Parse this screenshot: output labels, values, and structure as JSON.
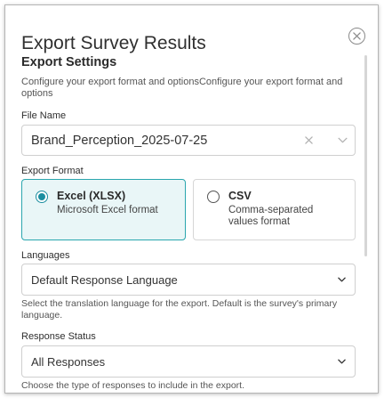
{
  "dialog": {
    "title": "Export Survey Results",
    "section_title": "Export Settings",
    "section_description": "Configure your export format and optionsConfigure your export format and options"
  },
  "file_name": {
    "label": "File Name",
    "value": "Brand_Perception_2025-07-25"
  },
  "export_format": {
    "label": "Export Format",
    "options": [
      {
        "name": "Excel (XLSX)",
        "description": "Microsoft Excel format",
        "selected": true
      },
      {
        "name": "CSV",
        "description": "Comma-separated values format",
        "selected": false
      }
    ]
  },
  "languages": {
    "label": "Languages",
    "value": "Default Response Language",
    "help": "Select the translation language for the export. Default is the survey's primary language."
  },
  "response_status": {
    "label": "Response Status",
    "value": "All Responses",
    "help": "Choose the type of responses to include in the export."
  },
  "colors": {
    "accent": "#1b8ea0",
    "selected_bg": "#e9f6f7",
    "selected_border": "#2aa6ae"
  },
  "icons": {
    "close": "close-icon",
    "clear": "clear-icon",
    "dropdown": "chevron-down-icon"
  }
}
